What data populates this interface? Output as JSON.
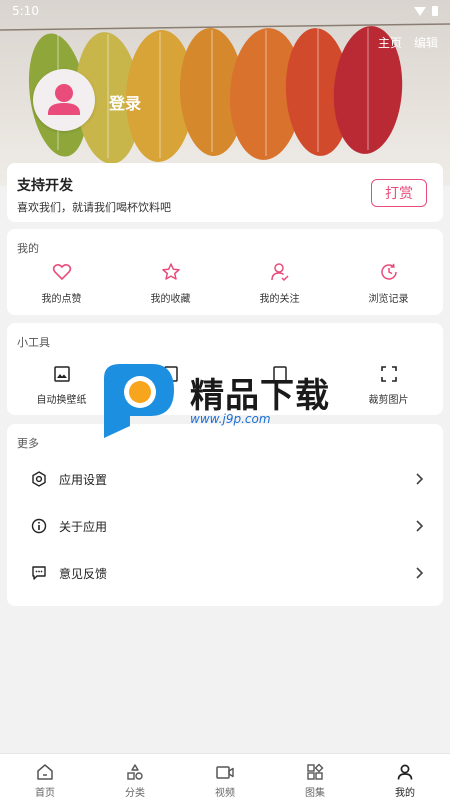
{
  "status": {
    "time": "5:10"
  },
  "header": {
    "home": "主页",
    "edit": "编辑",
    "login": "登录"
  },
  "support": {
    "title": "支持开发",
    "subtitle": "喜欢我们，就请我们喝杯饮料吧",
    "button": "打赏"
  },
  "mine": {
    "label": "我的",
    "items": [
      {
        "label": "我的点赞",
        "icon": "heart-icon"
      },
      {
        "label": "我的收藏",
        "icon": "star-icon"
      },
      {
        "label": "我的关注",
        "icon": "follow-user-icon"
      },
      {
        "label": "浏览记录",
        "icon": "history-icon"
      }
    ]
  },
  "tools": {
    "label": "小工具",
    "items": [
      {
        "label": "自动换壁纸",
        "icon": "auto-wallpaper-icon"
      },
      {
        "label": "",
        "icon": "tool-icon"
      },
      {
        "label": "",
        "icon": "tool-icon"
      },
      {
        "label": "裁剪图片",
        "icon": "crop-icon"
      }
    ]
  },
  "more": {
    "label": "更多",
    "items": [
      {
        "label": "应用设置",
        "icon": "settings-icon"
      },
      {
        "label": "关于应用",
        "icon": "info-icon"
      },
      {
        "label": "意见反馈",
        "icon": "feedback-icon"
      }
    ]
  },
  "watermark": {
    "text": "精品下载",
    "url": "www.j9p.com"
  },
  "nav": [
    {
      "label": "首页",
      "icon": "home-icon"
    },
    {
      "label": "分类",
      "icon": "category-icon"
    },
    {
      "label": "视频",
      "icon": "video-icon"
    },
    {
      "label": "图集",
      "icon": "gallery-icon"
    },
    {
      "label": "我的",
      "icon": "profile-icon"
    }
  ],
  "colors": {
    "accent": "#e94c7a",
    "background": "#f2f2f2"
  }
}
